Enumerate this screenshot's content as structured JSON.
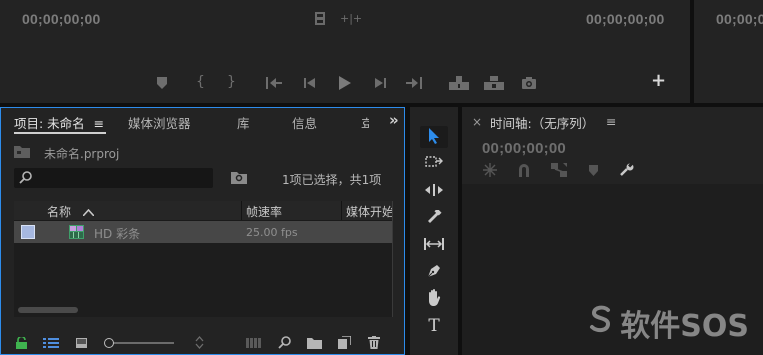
{
  "source_monitor": {
    "timecode_left": "00;00;00;00",
    "timecode_right": "00;00;00;00",
    "buttons": {
      "add": "+"
    }
  },
  "program_monitor": {
    "timecode": "00;00;00"
  },
  "project_panel": {
    "tabs": [
      {
        "label": "项目: 未命名",
        "menu": "≡"
      },
      {
        "label": "媒体浏览器"
      },
      {
        "label": "库"
      },
      {
        "label": "信息"
      },
      {
        "label": "효"
      }
    ],
    "overflow": "»",
    "project_file": "未命名.prproj",
    "search": {
      "value": "",
      "placeholder": ""
    },
    "selection_status": "1项已选择，共1项",
    "columns": [
      {
        "label": "名称",
        "sort": "^"
      },
      {
        "label": "帧速率"
      },
      {
        "label": "媒体开始"
      }
    ],
    "rows": [
      {
        "name": "HD 彩条",
        "fps": "25.00 fps"
      }
    ]
  },
  "timeline_panel": {
    "close": "×",
    "title": "时间轴:（无序列）",
    "menu": "≡",
    "timecode": "00;00;00;00"
  },
  "tools": [
    {
      "name": "selection-tool-icon"
    },
    {
      "name": "track-select-tool-icon"
    },
    {
      "name": "ripple-edit-tool-icon"
    },
    {
      "name": "razor-tool-icon"
    },
    {
      "name": "slip-tool-icon"
    },
    {
      "name": "pen-tool-icon"
    },
    {
      "name": "hand-tool-icon"
    },
    {
      "name": "type-tool-icon",
      "label": "T"
    }
  ],
  "watermark": "软件SOS",
  "colors": {
    "accent_blue": "#2d8ceb",
    "panel_bg": "#232323",
    "selection_row": "#474747",
    "label_swatch": "#a6b8e0",
    "green_lock": "#3fb34f"
  }
}
